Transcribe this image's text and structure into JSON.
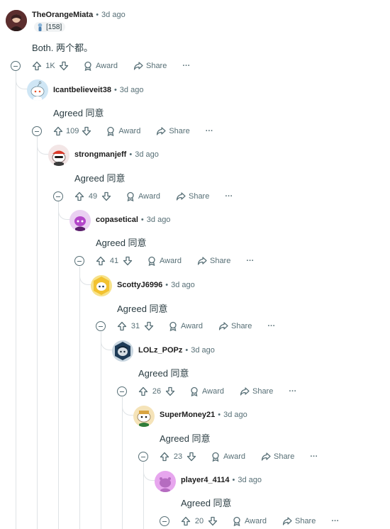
{
  "comments": [
    {
      "username": "TheOrangeMiata",
      "time": "3d ago",
      "flair": "[158]",
      "text": "Both.  两个都。",
      "votes": "1K",
      "award_label": "Award",
      "share_label": "Share",
      "more_label": "···",
      "avatar_color": "#7a3b3b"
    },
    {
      "username": "Icantbelieveit38",
      "time": "3d ago",
      "text": "Agreed   同意",
      "votes": "109",
      "award_label": "Award",
      "share_label": "Share",
      "more_label": "···",
      "avatar_color": "#cfe6f5"
    },
    {
      "username": "strongmanjeff",
      "time": "3d ago",
      "text": "Agreed   同意",
      "votes": "49",
      "award_label": "Award",
      "share_label": "Share",
      "more_label": "···",
      "avatar_color": "#f3e6e6"
    },
    {
      "username": "copasetical",
      "time": "3d ago",
      "text": "Agreed   同意",
      "votes": "41",
      "award_label": "Award",
      "share_label": "Share",
      "more_label": "···",
      "avatar_color": "#d9b3e8"
    },
    {
      "username": "ScottyJ6996",
      "time": "3d ago",
      "text": "Agreed   同意",
      "votes": "31",
      "award_label": "Award",
      "share_label": "Share",
      "more_label": "···",
      "avatar_color": "#f2d24b"
    },
    {
      "username": "LOLz_POPz",
      "time": "3d ago",
      "text": "Agreed   同意",
      "votes": "26",
      "award_label": "Award",
      "share_label": "Share",
      "more_label": "···",
      "avatar_color": "#1e3b57"
    },
    {
      "username": "SuperMoney21",
      "time": "3d ago",
      "text": "Agreed   同意",
      "votes": "23",
      "award_label": "Award",
      "share_label": "Share",
      "more_label": "···",
      "avatar_color": "#f5e3b8"
    },
    {
      "username": "player4_4114",
      "time": "3d ago",
      "text": "Agreed   同意",
      "votes": "20",
      "award_label": "Award",
      "share_label": "Share",
      "more_label": "···",
      "avatar_color": "#e7a6ee"
    }
  ],
  "separator": "•",
  "colors": {
    "muted": "#576f76",
    "thread_line": "#dfe3e6",
    "text": "#2a3c42"
  }
}
